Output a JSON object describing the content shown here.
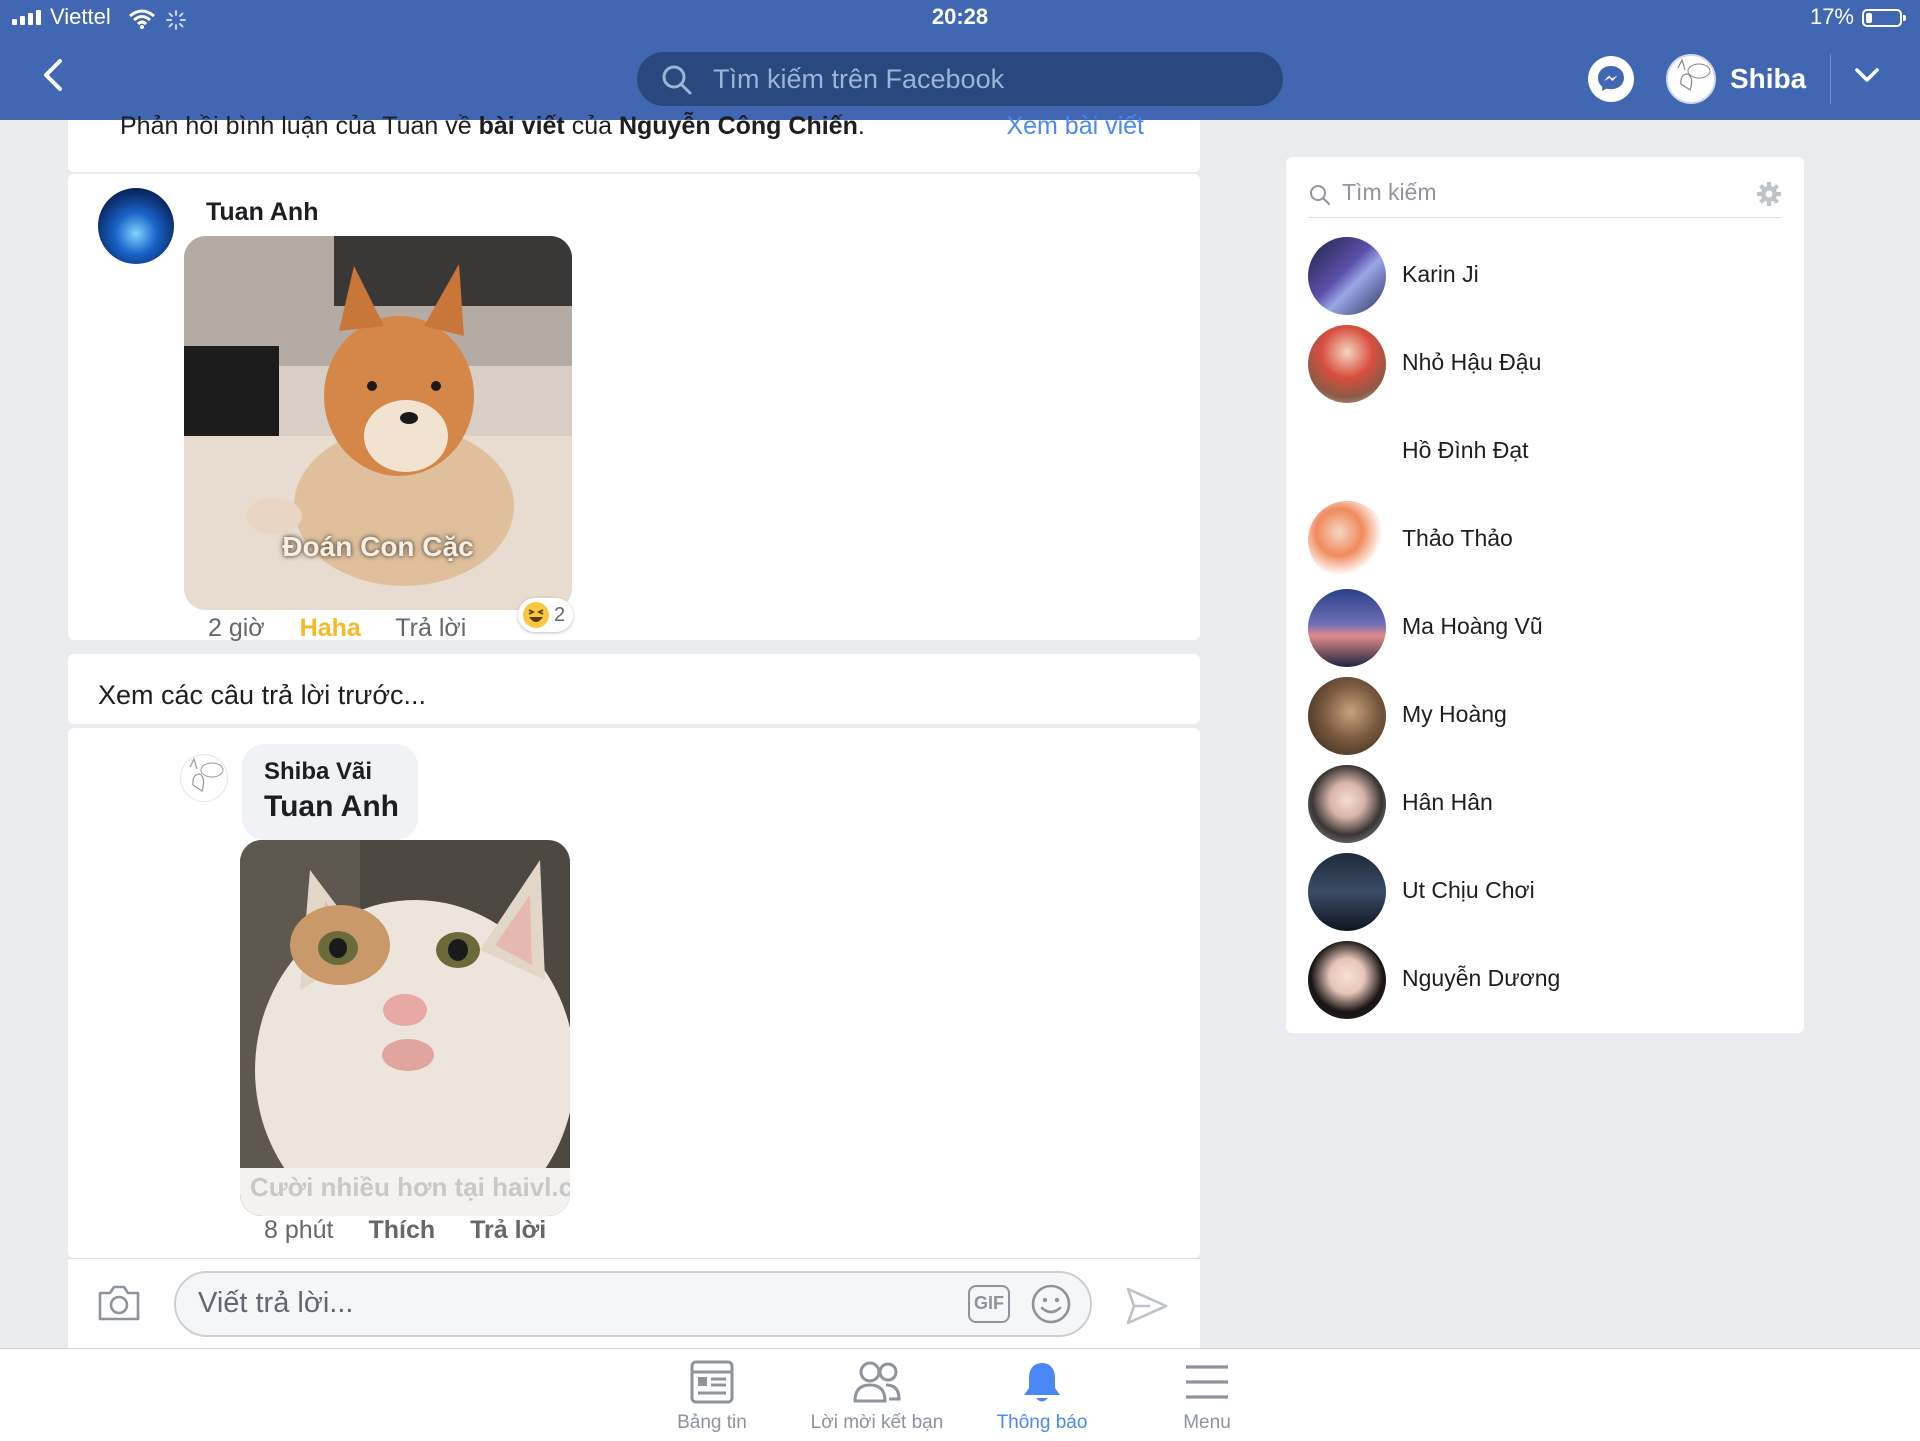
{
  "status_bar": {
    "carrier": "Viettel",
    "time": "20:28",
    "battery": "17%"
  },
  "header": {
    "search_placeholder": "Tìm kiếm trên Facebook",
    "profile_name": "Shiba"
  },
  "notification": {
    "prefix": "Phản hồi bình luận của Tuan về ",
    "post_word": "bài viết",
    "middle": " của ",
    "author": "Nguyễn Công Chiến",
    "suffix": ".",
    "link": "Xem bài viết"
  },
  "comment": {
    "author": "Tuan Anh",
    "image_caption": "Đoán Con Cặc",
    "time": "2 giờ",
    "reaction_label": "Haha",
    "reply_label": "Trả lời",
    "reaction_count": "2"
  },
  "previous_replies": "Xem các câu trả lời trước...",
  "reply": {
    "author": "Shiba Vãi",
    "mention": "Tuan Anh",
    "image_watermark": "Cười nhiều hơn tại haivl.c",
    "time": "8 phút",
    "like_label": "Thích",
    "reply_label": "Trả lời"
  },
  "composer": {
    "placeholder": "Viết trả lời...",
    "gif_label": "GIF"
  },
  "tabs": [
    {
      "label": "Bảng tin",
      "icon": "newsfeed-icon"
    },
    {
      "label": "Lời mời kết bạn",
      "icon": "friends-icon"
    },
    {
      "label": "Thông báo",
      "icon": "bell-icon"
    },
    {
      "label": "Menu",
      "icon": "menu-icon"
    }
  ],
  "contacts": {
    "search_placeholder": "Tìm kiếm",
    "items": [
      {
        "name": "Karin Ji"
      },
      {
        "name": "Nhỏ Hậu Đậu"
      },
      {
        "name": "Hồ Đình Đạt"
      },
      {
        "name": "Thảo Thảo"
      },
      {
        "name": "Ma Hoàng Vũ"
      },
      {
        "name": "My Hoàng"
      },
      {
        "name": "Hân Hân"
      },
      {
        "name": "Ut Chịu Chơi"
      },
      {
        "name": "Nguyễn Dương"
      }
    ]
  },
  "colors": {
    "header": "#4267b2",
    "search": "#29487d",
    "link": "#4a88f6",
    "haha": "#f7b928"
  }
}
